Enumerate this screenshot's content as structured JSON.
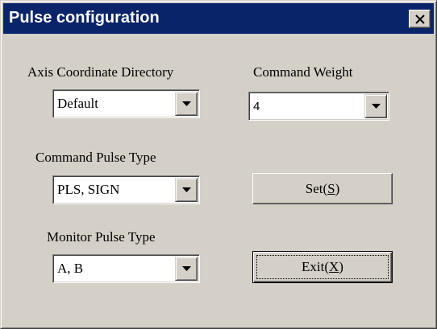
{
  "window": {
    "title": "Pulse configuration",
    "close_glyph": "×",
    "titlebar_color": "#0a246a",
    "face_color": "#d4d0c8"
  },
  "fields": {
    "axis": {
      "label": "Axis Coordinate Directory",
      "value": "Default"
    },
    "weight": {
      "label": "Command Weight",
      "value": "4"
    },
    "cmd_pulse": {
      "label": "Command Pulse Type",
      "value": "PLS, SIGN"
    },
    "mon_pulse": {
      "label": "Monitor Pulse Type",
      "value": "A, B"
    }
  },
  "buttons": {
    "set": {
      "prefix": "Set(",
      "mnemonic": "S",
      "suffix": ")"
    },
    "exit": {
      "prefix": "Exit(",
      "mnemonic": "X",
      "suffix": ")"
    }
  }
}
